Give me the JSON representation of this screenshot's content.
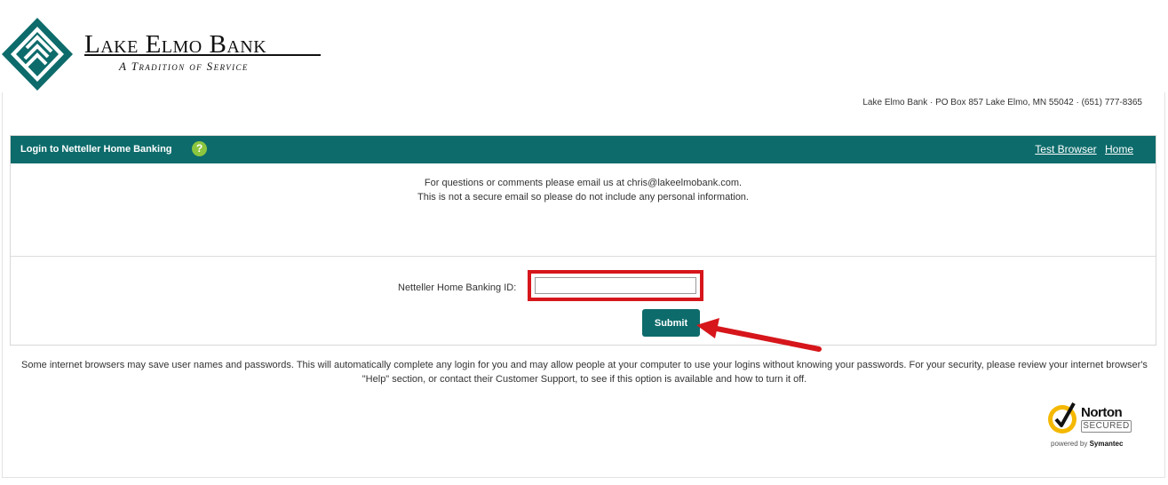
{
  "brand": {
    "name": "Lake Elmo Bank",
    "tagline": "A Tradition of Service",
    "colors": {
      "primary": "#0d6b6b",
      "accent": "#8cc63f",
      "highlight": "#d6161b"
    }
  },
  "address": "Lake Elmo Bank · PO Box 857 Lake Elmo, MN 55042 · (651) 777-8365",
  "panel": {
    "title": "Login to Netteller Home Banking",
    "help_icon": "?",
    "links": {
      "test_browser": "Test Browser",
      "home": "Home"
    },
    "notice_line1": "For questions or comments please email us at chris@lakeelmobank.com.",
    "notice_line2": "This is not a secure email so please do not include any personal information."
  },
  "login_form": {
    "id_label": "Netteller Home Banking ID:",
    "id_value": "",
    "submit_label": "Submit"
  },
  "disclaimer": "Some internet browsers may save user names and passwords. This will automatically complete any login for you and may allow people at your computer to use your logins without knowing your passwords. For your security, please review your internet browser's \"Help\" section, or contact their Customer Support, to see if this option is available and how to turn it off.",
  "norton_badge": {
    "name": "Norton",
    "secured": "SECURED",
    "powered_prefix": "powered by",
    "powered_brand": "Symantec"
  }
}
